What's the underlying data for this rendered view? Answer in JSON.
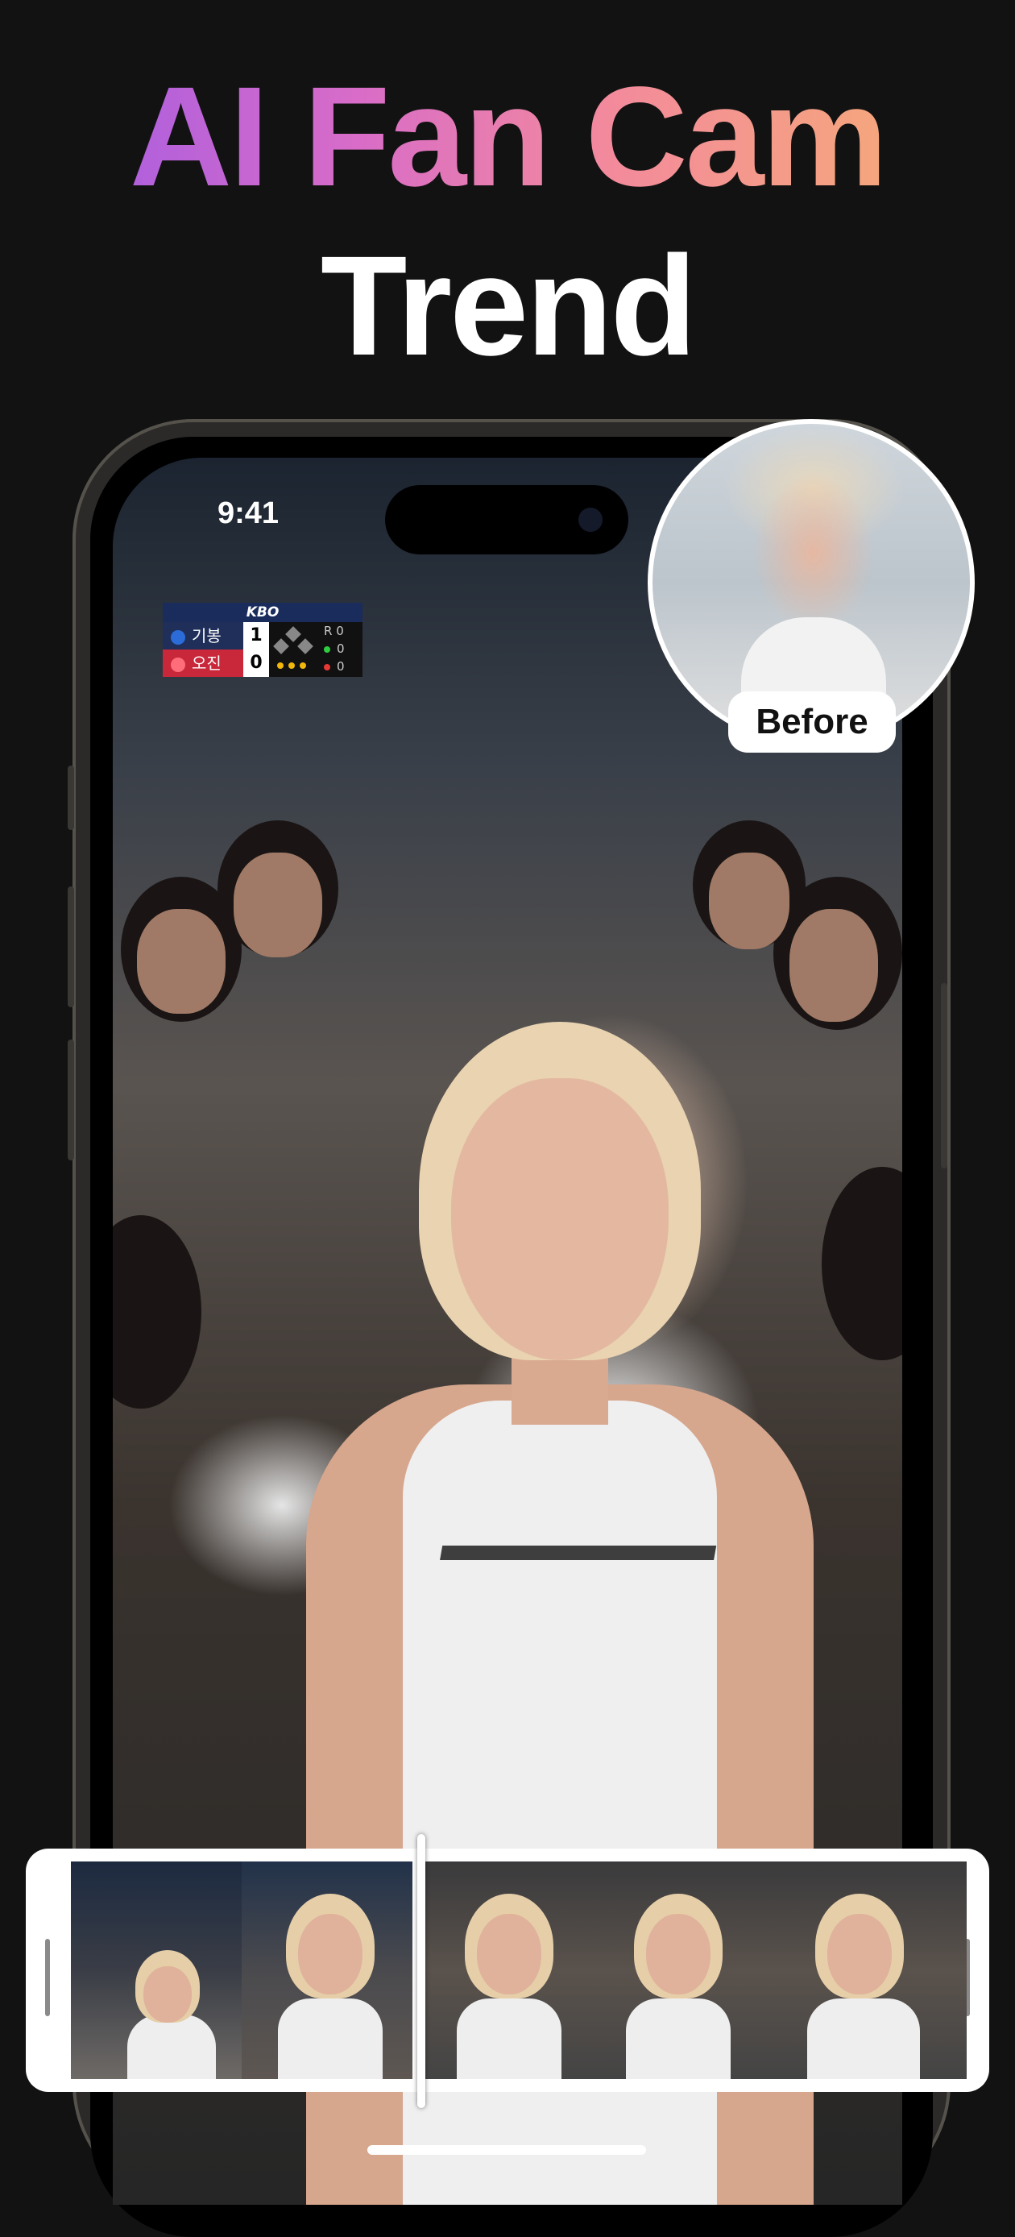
{
  "headline": {
    "line1": "AI Fan Cam",
    "line2": "Trend"
  },
  "phone": {
    "status_time": "9:41",
    "scoreboard": {
      "league": "KBO",
      "teams": [
        {
          "name": "기봉",
          "score": "1",
          "logo_color": "#2b6cd9"
        },
        {
          "name": "오진",
          "score": "0",
          "logo_color": "#d83040"
        }
      ],
      "counts": [
        {
          "label": "R",
          "value": "0",
          "color": "#888888"
        },
        {
          "label": "",
          "value": "0",
          "color": "#2ecc40"
        },
        {
          "label": "",
          "value": "0",
          "color": "#e53935"
        }
      ]
    }
  },
  "before": {
    "label": "Before"
  },
  "filmstrip": {
    "frames": [
      "frame-cheering",
      "frame-praying",
      "frame-calm",
      "frame-surprised",
      "frame-shocked"
    ]
  },
  "colors": {
    "background": "#121212",
    "gradient": [
      "#9b59e8",
      "#d86cc8",
      "#f38a9c",
      "#f6b36f"
    ]
  }
}
